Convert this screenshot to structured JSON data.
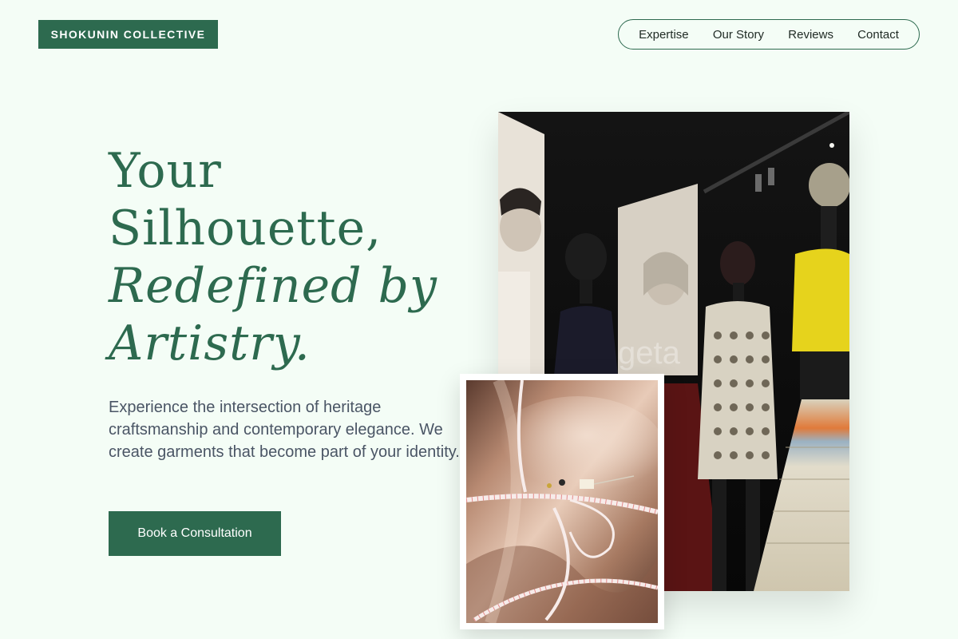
{
  "brand": {
    "name": "SHOKUNIN COLLECTIVE"
  },
  "nav": {
    "items": [
      {
        "label": "Expertise"
      },
      {
        "label": "Our Story"
      },
      {
        "label": "Reviews"
      },
      {
        "label": "Contact"
      }
    ]
  },
  "hero": {
    "headline_line1": "Your",
    "headline_line2": "Silhouette,",
    "headline_line3": "Redefined by",
    "headline_line4": "Artistry.",
    "description": "Experience the intersection of heritage craftsmanship and contemporary elegance. We create garments that become part of your identity.",
    "cta_label": "Book a Consultation"
  },
  "images": {
    "main_watermark": "geta"
  },
  "colors": {
    "brand_green": "#2d6a4f",
    "background": "#f4fdf6",
    "body_text": "#4a5565"
  }
}
